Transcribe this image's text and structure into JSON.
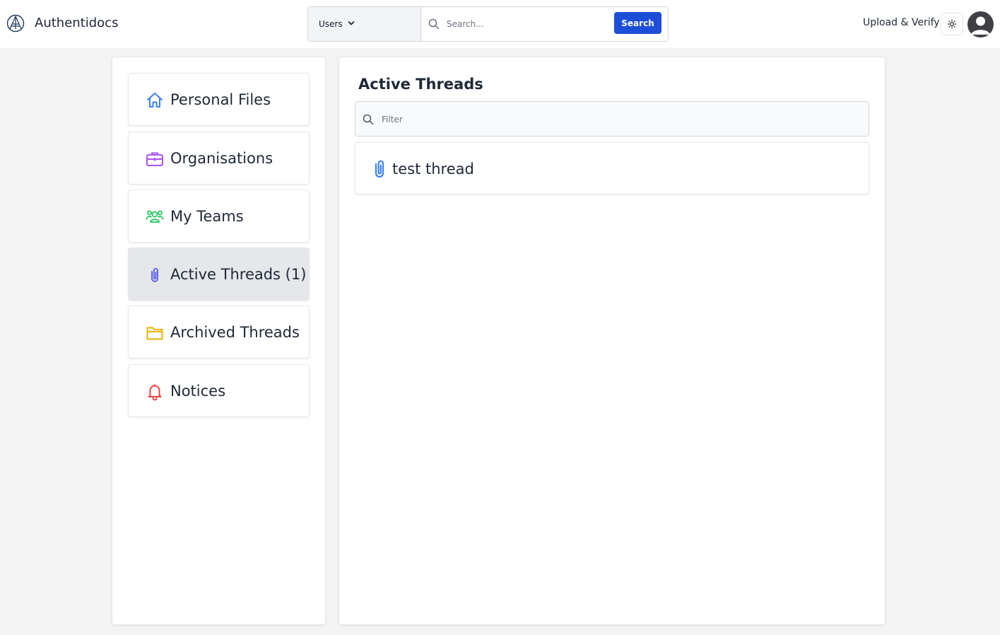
{
  "header": {
    "brand_name": "Authentidocs",
    "scope_value": "Users",
    "search_placeholder": "Search...",
    "search_button": "Search",
    "upload_link": "Upload & Verify"
  },
  "sidebar": {
    "items": [
      {
        "label": "Personal Files",
        "icon": "home-icon",
        "color": "#3b82f6"
      },
      {
        "label": "Organisations",
        "icon": "briefcase-icon",
        "color": "#a855f7"
      },
      {
        "label": "My Teams",
        "icon": "users-icon",
        "color": "#22c55e"
      },
      {
        "label": "Active Threads (1)",
        "icon": "paperclip-icon",
        "color": "#6366f1",
        "active": true
      },
      {
        "label": "Archived Threads",
        "icon": "folder-icon",
        "color": "#eab308"
      },
      {
        "label": "Notices",
        "icon": "bell-icon",
        "color": "#ef4444"
      }
    ]
  },
  "main": {
    "title": "Active Threads",
    "filter_placeholder": "Filter",
    "threads": [
      {
        "label": "test thread",
        "icon": "paperclip-icon",
        "color": "#3b82f6"
      }
    ]
  },
  "colors": {
    "accent": "#1d4ed8",
    "active_item_bg": "#e5e7eb",
    "page_bg": "#f4f4f5"
  }
}
